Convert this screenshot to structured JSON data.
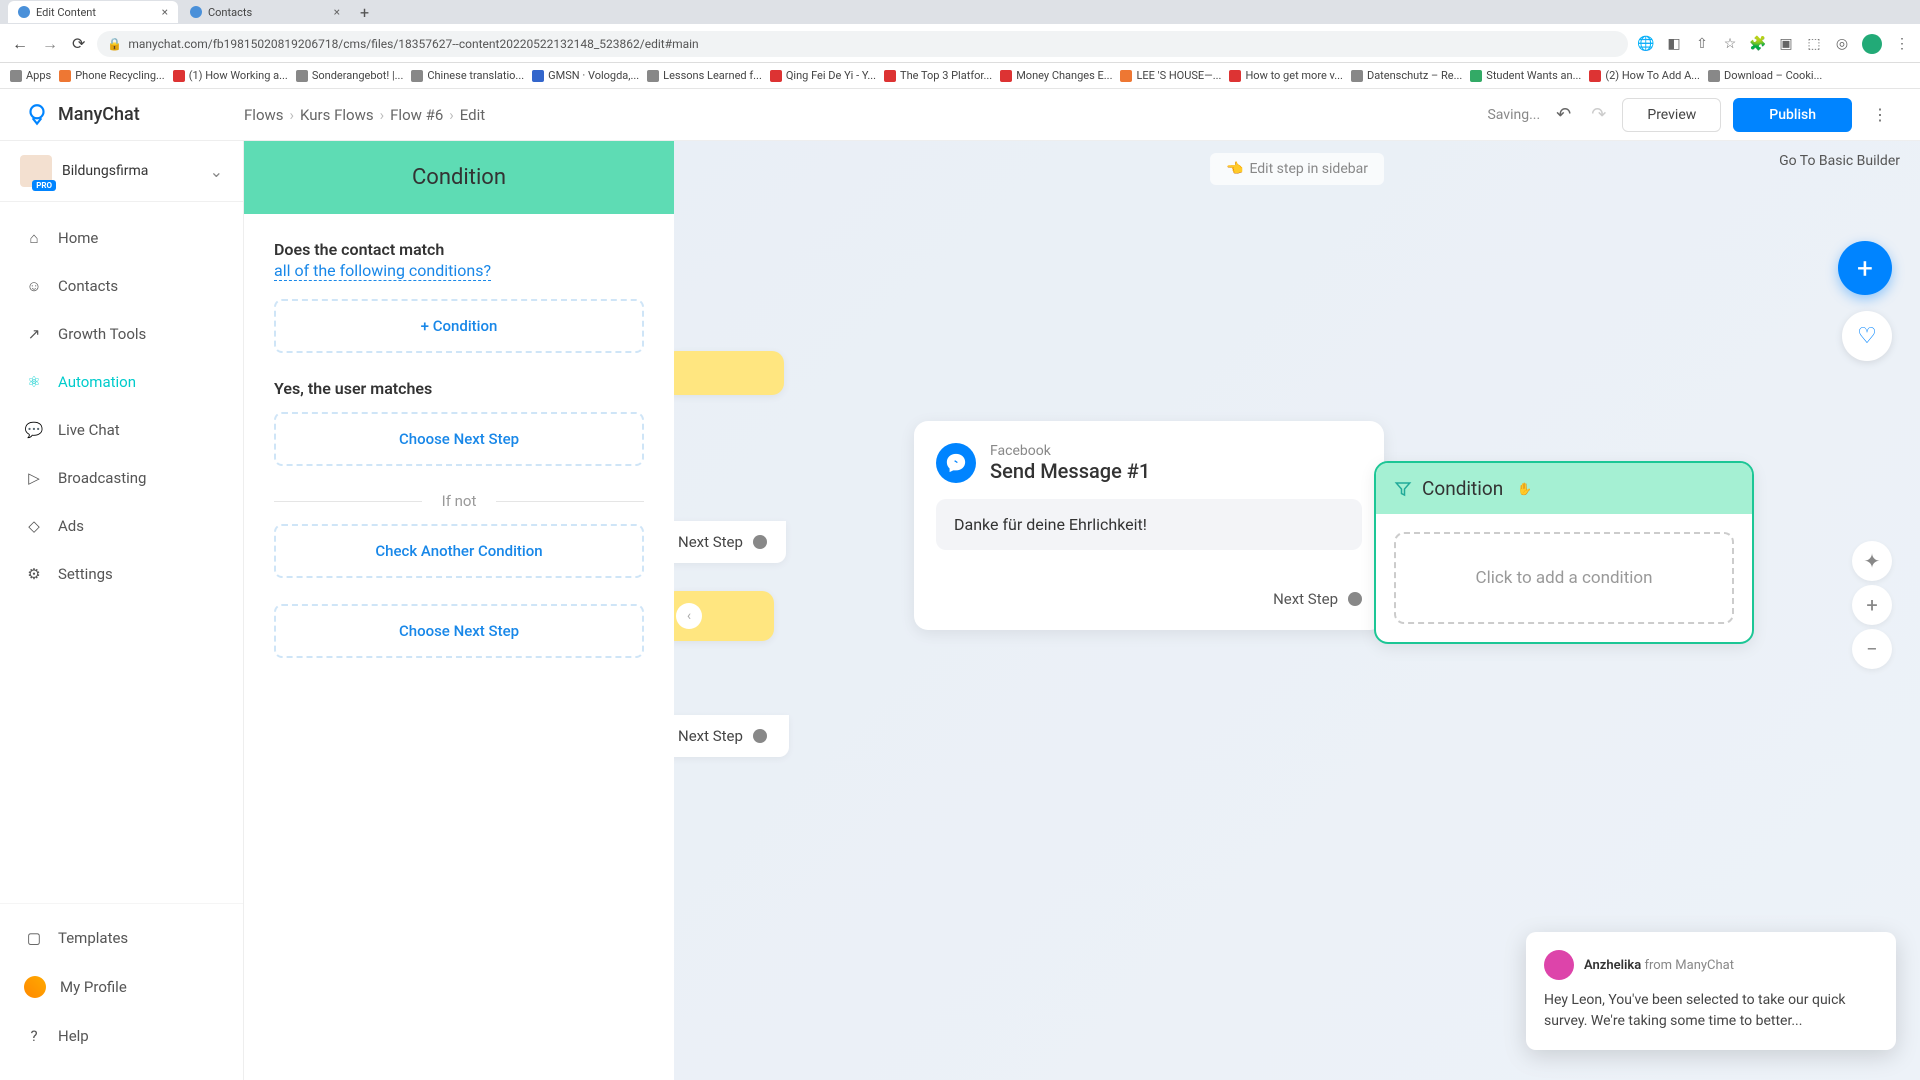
{
  "browser": {
    "tabs": [
      {
        "title": "Edit Content",
        "active": true
      },
      {
        "title": "Contacts",
        "active": false
      }
    ],
    "url": "manychat.com/fb19815020819206718/cms/files/18357627--content20220522132148_523862/edit#main",
    "bookmarks": [
      "Apps",
      "Phone Recycling...",
      "(1) How Working a...",
      "Sonderangebot! |...",
      "Chinese translatio...",
      "GMSN · Vologda,...",
      "Lessons Learned f...",
      "Qing Fei De Yi - Y...",
      "The Top 3 Platfor...",
      "Money Changes E...",
      "LEE 'S HOUSE—...",
      "How to get more v...",
      "Datenschutz – Re...",
      "Student Wants an...",
      "(2) How To Add A...",
      "Download – Cooki..."
    ]
  },
  "header": {
    "brand": "ManyChat",
    "breadcrumbs": [
      "Flows",
      "Kurs Flows",
      "Flow #6",
      "Edit"
    ],
    "status": "Saving...",
    "preview": "Preview",
    "publish": "Publish"
  },
  "workspace": {
    "name": "Bildungsfirma",
    "badge": "PRO"
  },
  "nav": {
    "items": [
      "Home",
      "Contacts",
      "Growth Tools",
      "Automation",
      "Live Chat",
      "Broadcasting",
      "Ads",
      "Settings"
    ],
    "activeIndex": 3,
    "bottom": [
      "Templates",
      "My Profile",
      "Help"
    ]
  },
  "panel": {
    "title": "Condition",
    "question": "Does the contact match",
    "questionLink": "all of the following conditions?",
    "addCondition": "+ Condition",
    "yesLabel": "Yes, the user matches",
    "chooseNext": "Choose Next Step",
    "ifNot": "If not",
    "checkAnother": "Check Another Condition"
  },
  "canvas": {
    "editHint": "Edit step in sidebar",
    "basicBuilder": "Go To Basic Builder",
    "nextStep": "Next Step",
    "message": {
      "platform": "Facebook",
      "name": "Send Message #1",
      "text": "Danke für deine Ehrlichkeit!"
    },
    "condition": {
      "title": "Condition",
      "placeholder": "Click to add a condition"
    }
  },
  "chat": {
    "name": "Anzhelika",
    "from": "from ManyChat",
    "text": "Hey Leon,  You've been selected to take our quick survey. We're taking some time to better..."
  }
}
